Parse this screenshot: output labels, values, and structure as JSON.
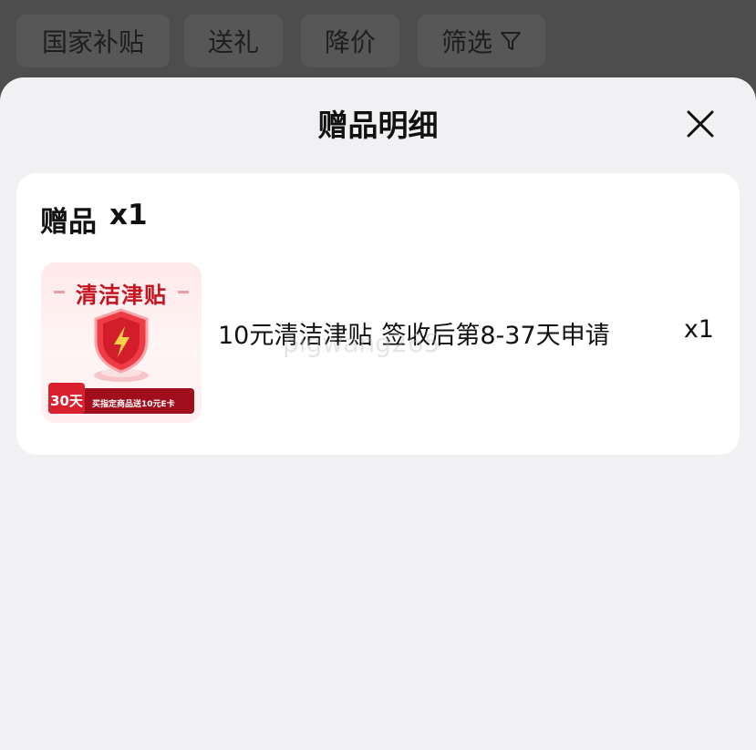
{
  "filter_bar": {
    "chips": [
      "国家补贴",
      "送礼",
      "降价",
      "筛选"
    ],
    "filter_icon": "filter-icon"
  },
  "sheet": {
    "title": "赠品明细",
    "close_icon": "close-icon"
  },
  "gift_card": {
    "heading": "赠品",
    "count": "x1",
    "item": {
      "thumbnail": {
        "title": "清洁津贴",
        "badge_days": "30天",
        "banner_text": "买指定商品送10元E卡"
      },
      "name": "10元清洁津贴",
      "note": "签收后第8-37天申请",
      "quantity": "x1"
    }
  },
  "watermark": "pigwang265",
  "colors": {
    "overlay": "#4d4d4d",
    "sheet_bg": "#f1f1f4",
    "card_bg": "#ffffff",
    "brand_red": "#c5121f"
  }
}
